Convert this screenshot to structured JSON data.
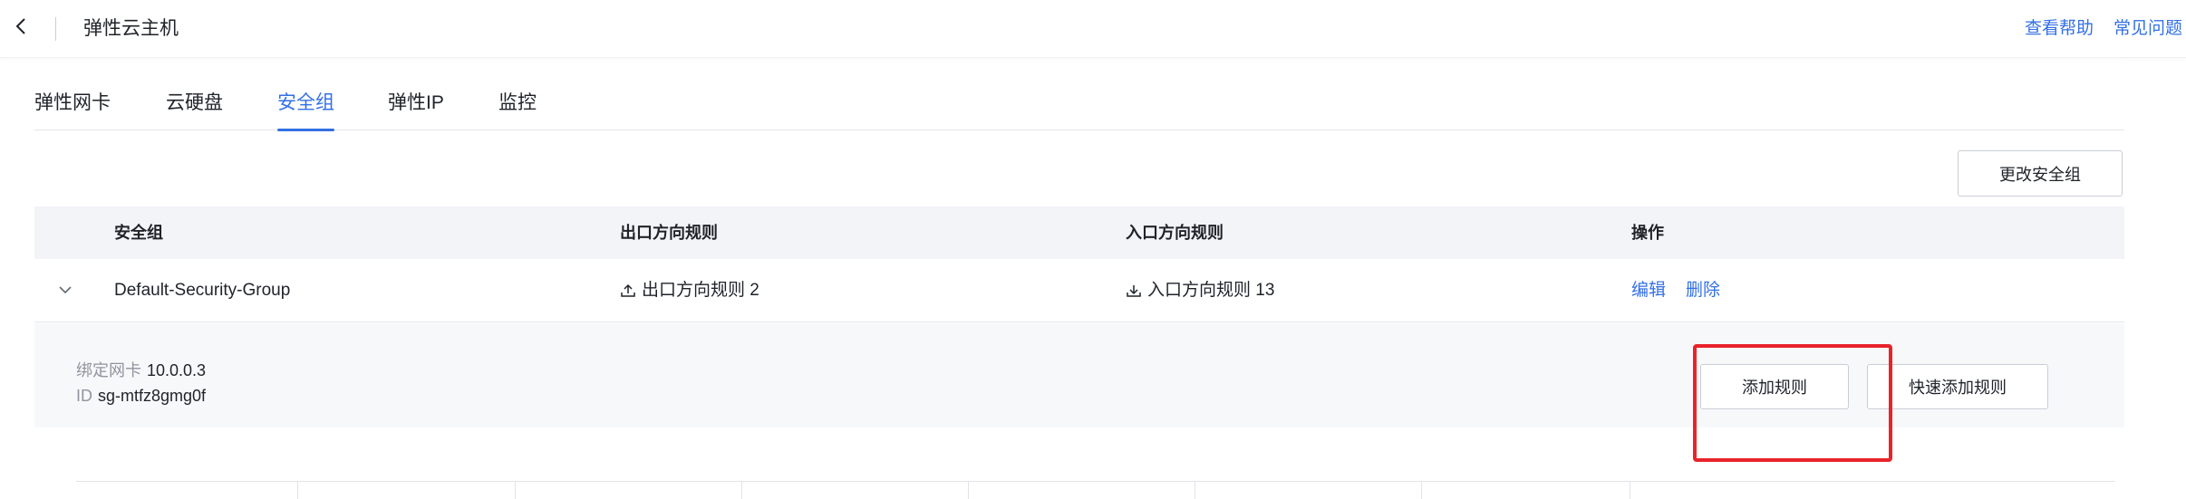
{
  "header": {
    "title": "弹性云主机",
    "links": [
      "查看帮助",
      "常见问题"
    ]
  },
  "tabs": [
    {
      "label": "弹性网卡",
      "active": false
    },
    {
      "label": "云硬盘",
      "active": false
    },
    {
      "label": "安全组",
      "active": true
    },
    {
      "label": "弹性IP",
      "active": false
    },
    {
      "label": "监控",
      "active": false
    }
  ],
  "toolbar": {
    "change_security_group": "更改安全组"
  },
  "table": {
    "columns": [
      "安全组",
      "出口方向规则",
      "入口方向规则",
      "操作"
    ],
    "rows": [
      {
        "name": "Default-Security-Group",
        "egress": "出口方向规则 2",
        "ingress": "入口方向规则 13",
        "actions": [
          "编辑",
          "删除"
        ]
      }
    ]
  },
  "expanded": {
    "nic_label": "绑定网卡",
    "nic_value": "10.0.0.3",
    "id_label": "ID",
    "id_value": "sg-mtfz8gmg0f",
    "add_rule": "添加规则",
    "quick_add_rule": "快速添加规则"
  },
  "colors": {
    "accent": "#3370e5",
    "highlight": "#e8242b",
    "table_header_bg": "#f2f4f8"
  }
}
